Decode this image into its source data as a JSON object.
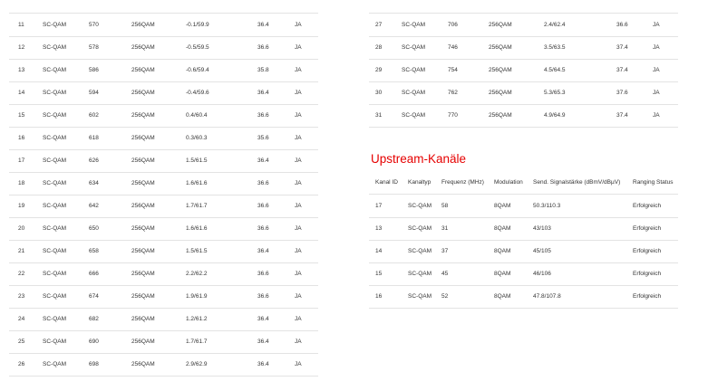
{
  "downstream_left": {
    "rows": [
      [
        "11",
        "SC-QAM",
        "570",
        "256QAM",
        "-0.1/59.9",
        "36.4",
        "JA"
      ],
      [
        "12",
        "SC-QAM",
        "578",
        "256QAM",
        "-0.5/59.5",
        "36.6",
        "JA"
      ],
      [
        "13",
        "SC-QAM",
        "586",
        "256QAM",
        "-0.6/59.4",
        "35.8",
        "JA"
      ],
      [
        "14",
        "SC-QAM",
        "594",
        "256QAM",
        "-0.4/59.6",
        "36.4",
        "JA"
      ],
      [
        "15",
        "SC-QAM",
        "602",
        "256QAM",
        "0.4/60.4",
        "36.6",
        "JA"
      ],
      [
        "16",
        "SC-QAM",
        "618",
        "256QAM",
        "0.3/60.3",
        "35.6",
        "JA"
      ],
      [
        "17",
        "SC-QAM",
        "626",
        "256QAM",
        "1.5/61.5",
        "36.4",
        "JA"
      ],
      [
        "18",
        "SC-QAM",
        "634",
        "256QAM",
        "1.6/61.6",
        "36.6",
        "JA"
      ],
      [
        "19",
        "SC-QAM",
        "642",
        "256QAM",
        "1.7/61.7",
        "36.6",
        "JA"
      ],
      [
        "20",
        "SC-QAM",
        "650",
        "256QAM",
        "1.6/61.6",
        "36.6",
        "JA"
      ],
      [
        "21",
        "SC-QAM",
        "658",
        "256QAM",
        "1.5/61.5",
        "36.4",
        "JA"
      ],
      [
        "22",
        "SC-QAM",
        "666",
        "256QAM",
        "2.2/62.2",
        "36.6",
        "JA"
      ],
      [
        "23",
        "SC-QAM",
        "674",
        "256QAM",
        "1.9/61.9",
        "36.6",
        "JA"
      ],
      [
        "24",
        "SC-QAM",
        "682",
        "256QAM",
        "1.2/61.2",
        "36.4",
        "JA"
      ],
      [
        "25",
        "SC-QAM",
        "690",
        "256QAM",
        "1.7/61.7",
        "36.4",
        "JA"
      ],
      [
        "26",
        "SC-QAM",
        "698",
        "256QAM",
        "2.9/62.9",
        "36.4",
        "JA"
      ]
    ]
  },
  "downstream_right": {
    "rows": [
      [
        "27",
        "SC-QAM",
        "706",
        "256QAM",
        "2.4/62.4",
        "36.6",
        "JA"
      ],
      [
        "28",
        "SC-QAM",
        "746",
        "256QAM",
        "3.5/63.5",
        "37.4",
        "JA"
      ],
      [
        "29",
        "SC-QAM",
        "754",
        "256QAM",
        "4.5/64.5",
        "37.4",
        "JA"
      ],
      [
        "30",
        "SC-QAM",
        "762",
        "256QAM",
        "5.3/65.3",
        "37.6",
        "JA"
      ],
      [
        "31",
        "SC-QAM",
        "770",
        "256QAM",
        "4.9/64.9",
        "37.4",
        "JA"
      ]
    ]
  },
  "upstream": {
    "title": "Upstream-Kanäle",
    "headers": [
      "Kanal ID",
      "Kanaltyp",
      "Frequenz (MHz)",
      "Modulation",
      "Send. Signalstärke (dBmV/dBµV)",
      "Ranging Status"
    ],
    "rows": [
      [
        "17",
        "SC-QAM",
        "58",
        "8QAM",
        "50.3/110.3",
        "Erfolgreich"
      ],
      [
        "13",
        "SC-QAM",
        "31",
        "8QAM",
        "43/103",
        "Erfolgreich"
      ],
      [
        "14",
        "SC-QAM",
        "37",
        "8QAM",
        "45/105",
        "Erfolgreich"
      ],
      [
        "15",
        "SC-QAM",
        "45",
        "8QAM",
        "46/106",
        "Erfolgreich"
      ],
      [
        "16",
        "SC-QAM",
        "52",
        "8QAM",
        "47.8/107.8",
        "Erfolgreich"
      ]
    ]
  },
  "colors": {
    "accent": "#e60000",
    "text": "#333333",
    "divider": "#e3e3e3"
  }
}
